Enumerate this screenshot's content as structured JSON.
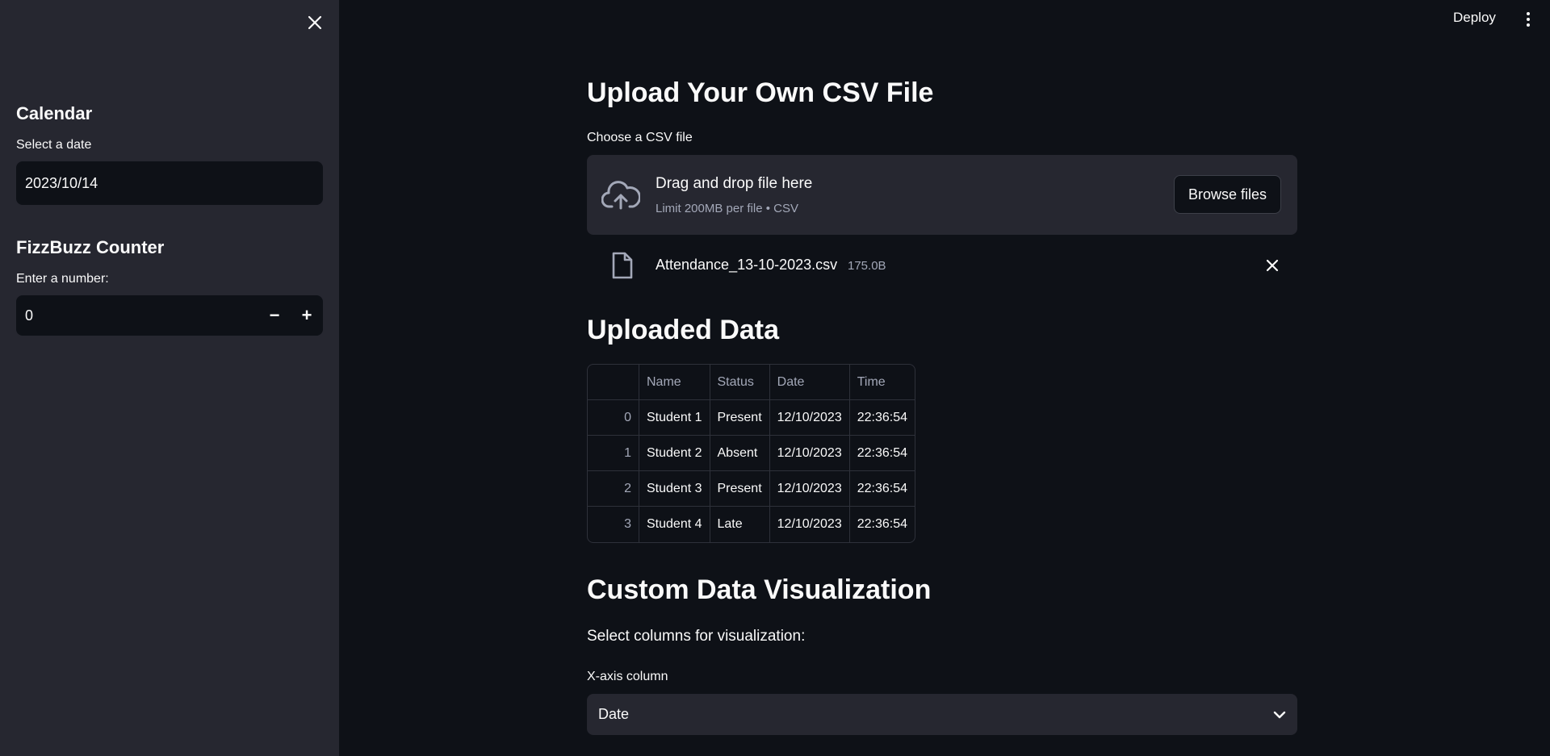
{
  "topbar": {
    "deploy_label": "Deploy"
  },
  "sidebar": {
    "calendar": {
      "heading": "Calendar",
      "label": "Select a date",
      "value": "2023/10/14"
    },
    "fizzbuzz": {
      "heading": "FizzBuzz Counter",
      "label": "Enter a number:",
      "value": "0",
      "minus": "−",
      "plus": "+"
    }
  },
  "upload": {
    "heading": "Upload Your Own CSV File",
    "label": "Choose a CSV file",
    "dropzone_title": "Drag and drop file here",
    "dropzone_sub": "Limit 200MB per file • CSV",
    "browse_label": "Browse files",
    "file_name": "Attendance_13-10-2023.csv",
    "file_size": "175.0B"
  },
  "uploaded": {
    "heading": "Uploaded Data",
    "columns": [
      "",
      "Name",
      "Status",
      "Date",
      "Time"
    ],
    "rows": [
      [
        "0",
        "Student 1",
        "Present",
        "12/10/2023",
        "22:36:54"
      ],
      [
        "1",
        "Student 2",
        "Absent",
        "12/10/2023",
        "22:36:54"
      ],
      [
        "2",
        "Student 3",
        "Present",
        "12/10/2023",
        "22:36:54"
      ],
      [
        "3",
        "Student 4",
        "Late",
        "12/10/2023",
        "22:36:54"
      ]
    ]
  },
  "viz": {
    "heading": "Custom Data Visualization",
    "subtitle": "Select columns for visualization:",
    "x_label": "X-axis column",
    "x_value": "Date"
  },
  "icons": [
    "close-icon",
    "cloud-upload-icon",
    "file-icon",
    "chevron-down-icon",
    "more-vert-icon"
  ]
}
